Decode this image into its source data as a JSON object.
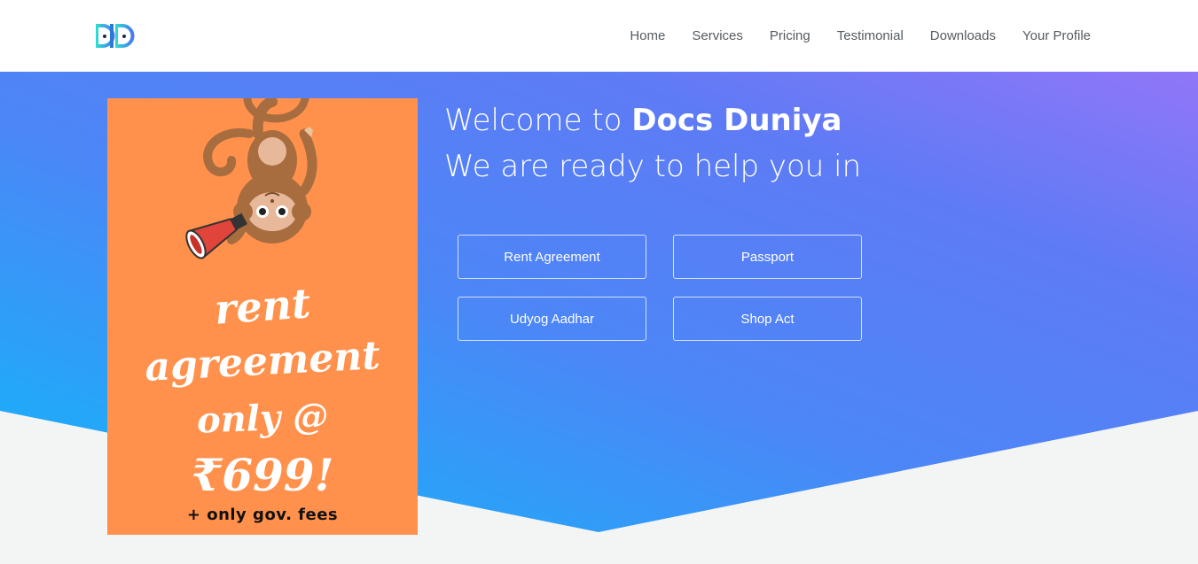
{
  "nav": {
    "logo_text": "DD",
    "links": [
      "Home",
      "Services",
      "Pricing",
      "Testimonial",
      "Downloads",
      "Your Profile"
    ]
  },
  "poster": {
    "line1": "rent",
    "line2": "agreement",
    "line3": "only @",
    "line4": "₹699!",
    "fees": "+ only gov. fees"
  },
  "hero": {
    "welcome_prefix": "Welcome to ",
    "brand": "Docs Duniya",
    "subtitle": "We are ready to help you in",
    "services": [
      "Rent Agreement",
      "Passport",
      "Udyog Aadhar",
      "Shop Act"
    ]
  },
  "colors": {
    "gradient_start": "#16b5f8",
    "gradient_mid": "#5d7cf6",
    "gradient_end": "#9276f8",
    "poster_bg": "#ff914d",
    "page_bg": "#f3f4f4"
  }
}
